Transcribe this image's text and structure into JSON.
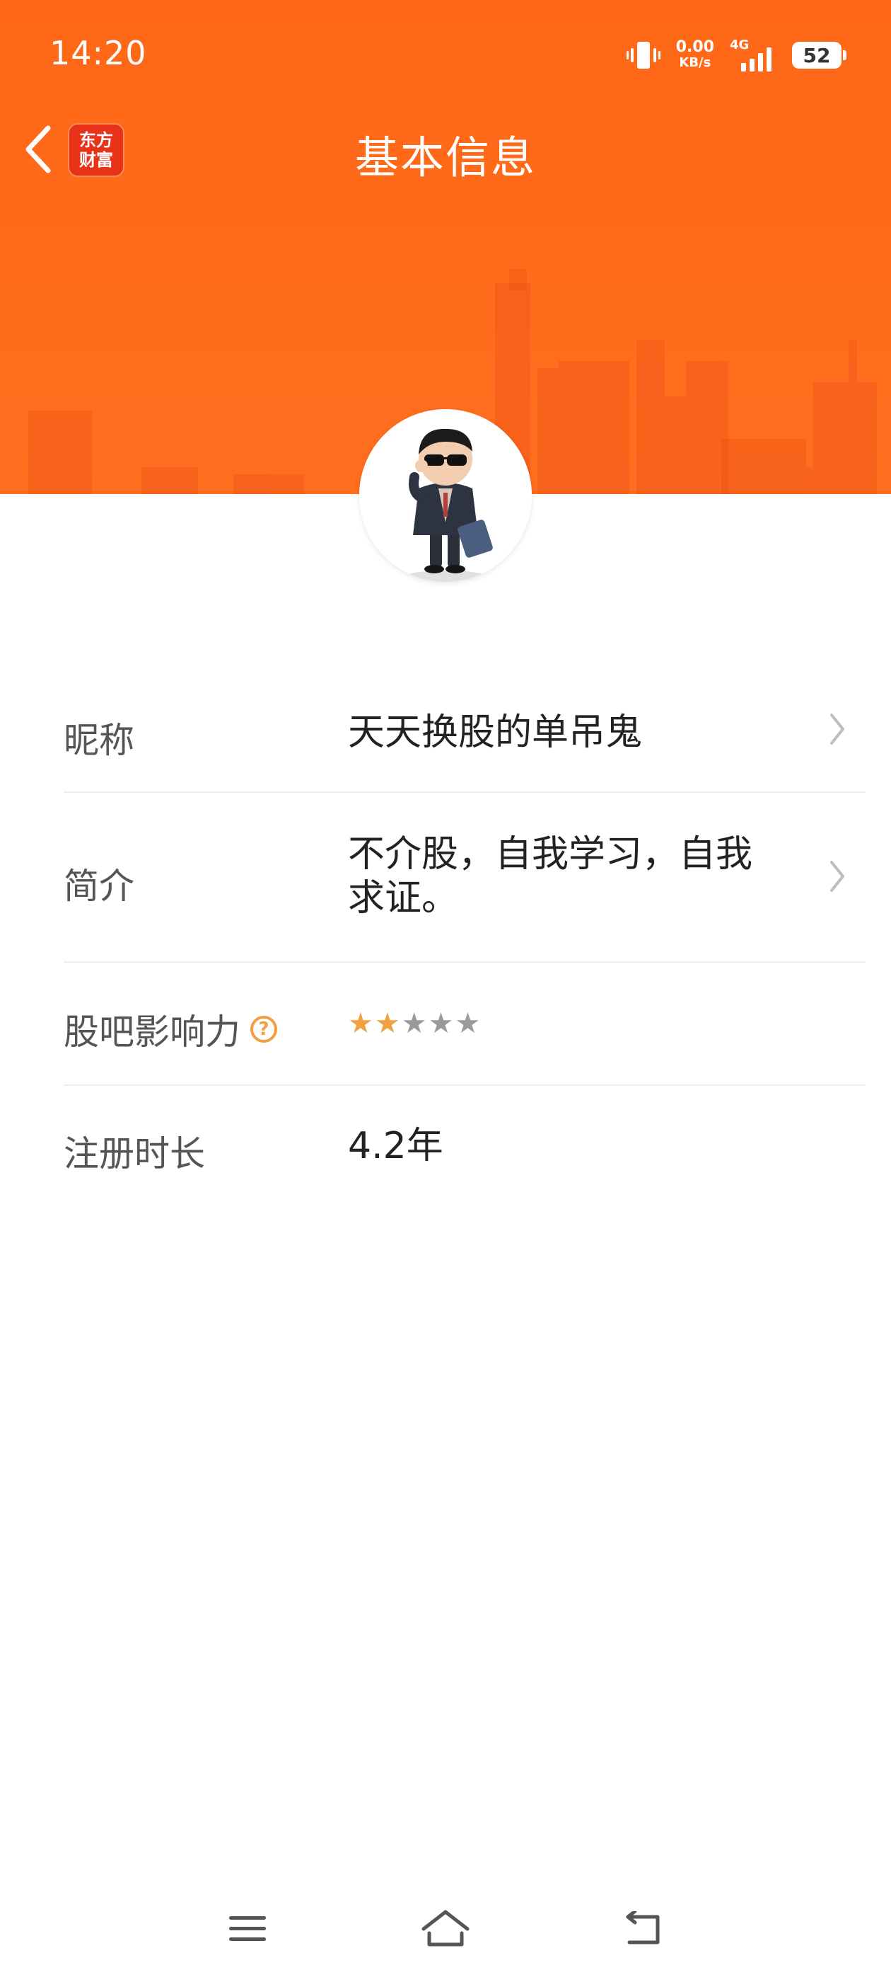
{
  "status_bar": {
    "time": "14:20",
    "net_speed_value": "0.00",
    "net_speed_unit": "KB/s",
    "network_type": "4G",
    "battery": "52",
    "icons": [
      "vibrate-icon",
      "signal-icon",
      "battery-icon"
    ]
  },
  "header": {
    "title": "基本信息",
    "logo_line1": "东方",
    "logo_line2": "财富",
    "back_icon": "chevron-left-icon",
    "accent_color": "#ff6a1a"
  },
  "profile": {
    "avatar_icon": "avatar-character"
  },
  "rows": [
    {
      "label": "昵称",
      "value": "天天换股的单吊鬼",
      "has_chevron": true
    },
    {
      "label": "简介",
      "value_line1": "不介股，自我学习，自我",
      "value_line2": "求证。",
      "has_chevron": true
    },
    {
      "label": "股吧影响力",
      "help_icon": "?",
      "rating": 2,
      "rating_max": 5
    },
    {
      "label": "注册时长",
      "value": "4.2年"
    }
  ],
  "bottom_nav": {
    "icons": [
      "menu-icon",
      "home-icon",
      "back-icon"
    ]
  },
  "colors": {
    "star_active": "#f0a040",
    "star_inactive": "#9a9a9a",
    "divider": "#eeeeee"
  }
}
